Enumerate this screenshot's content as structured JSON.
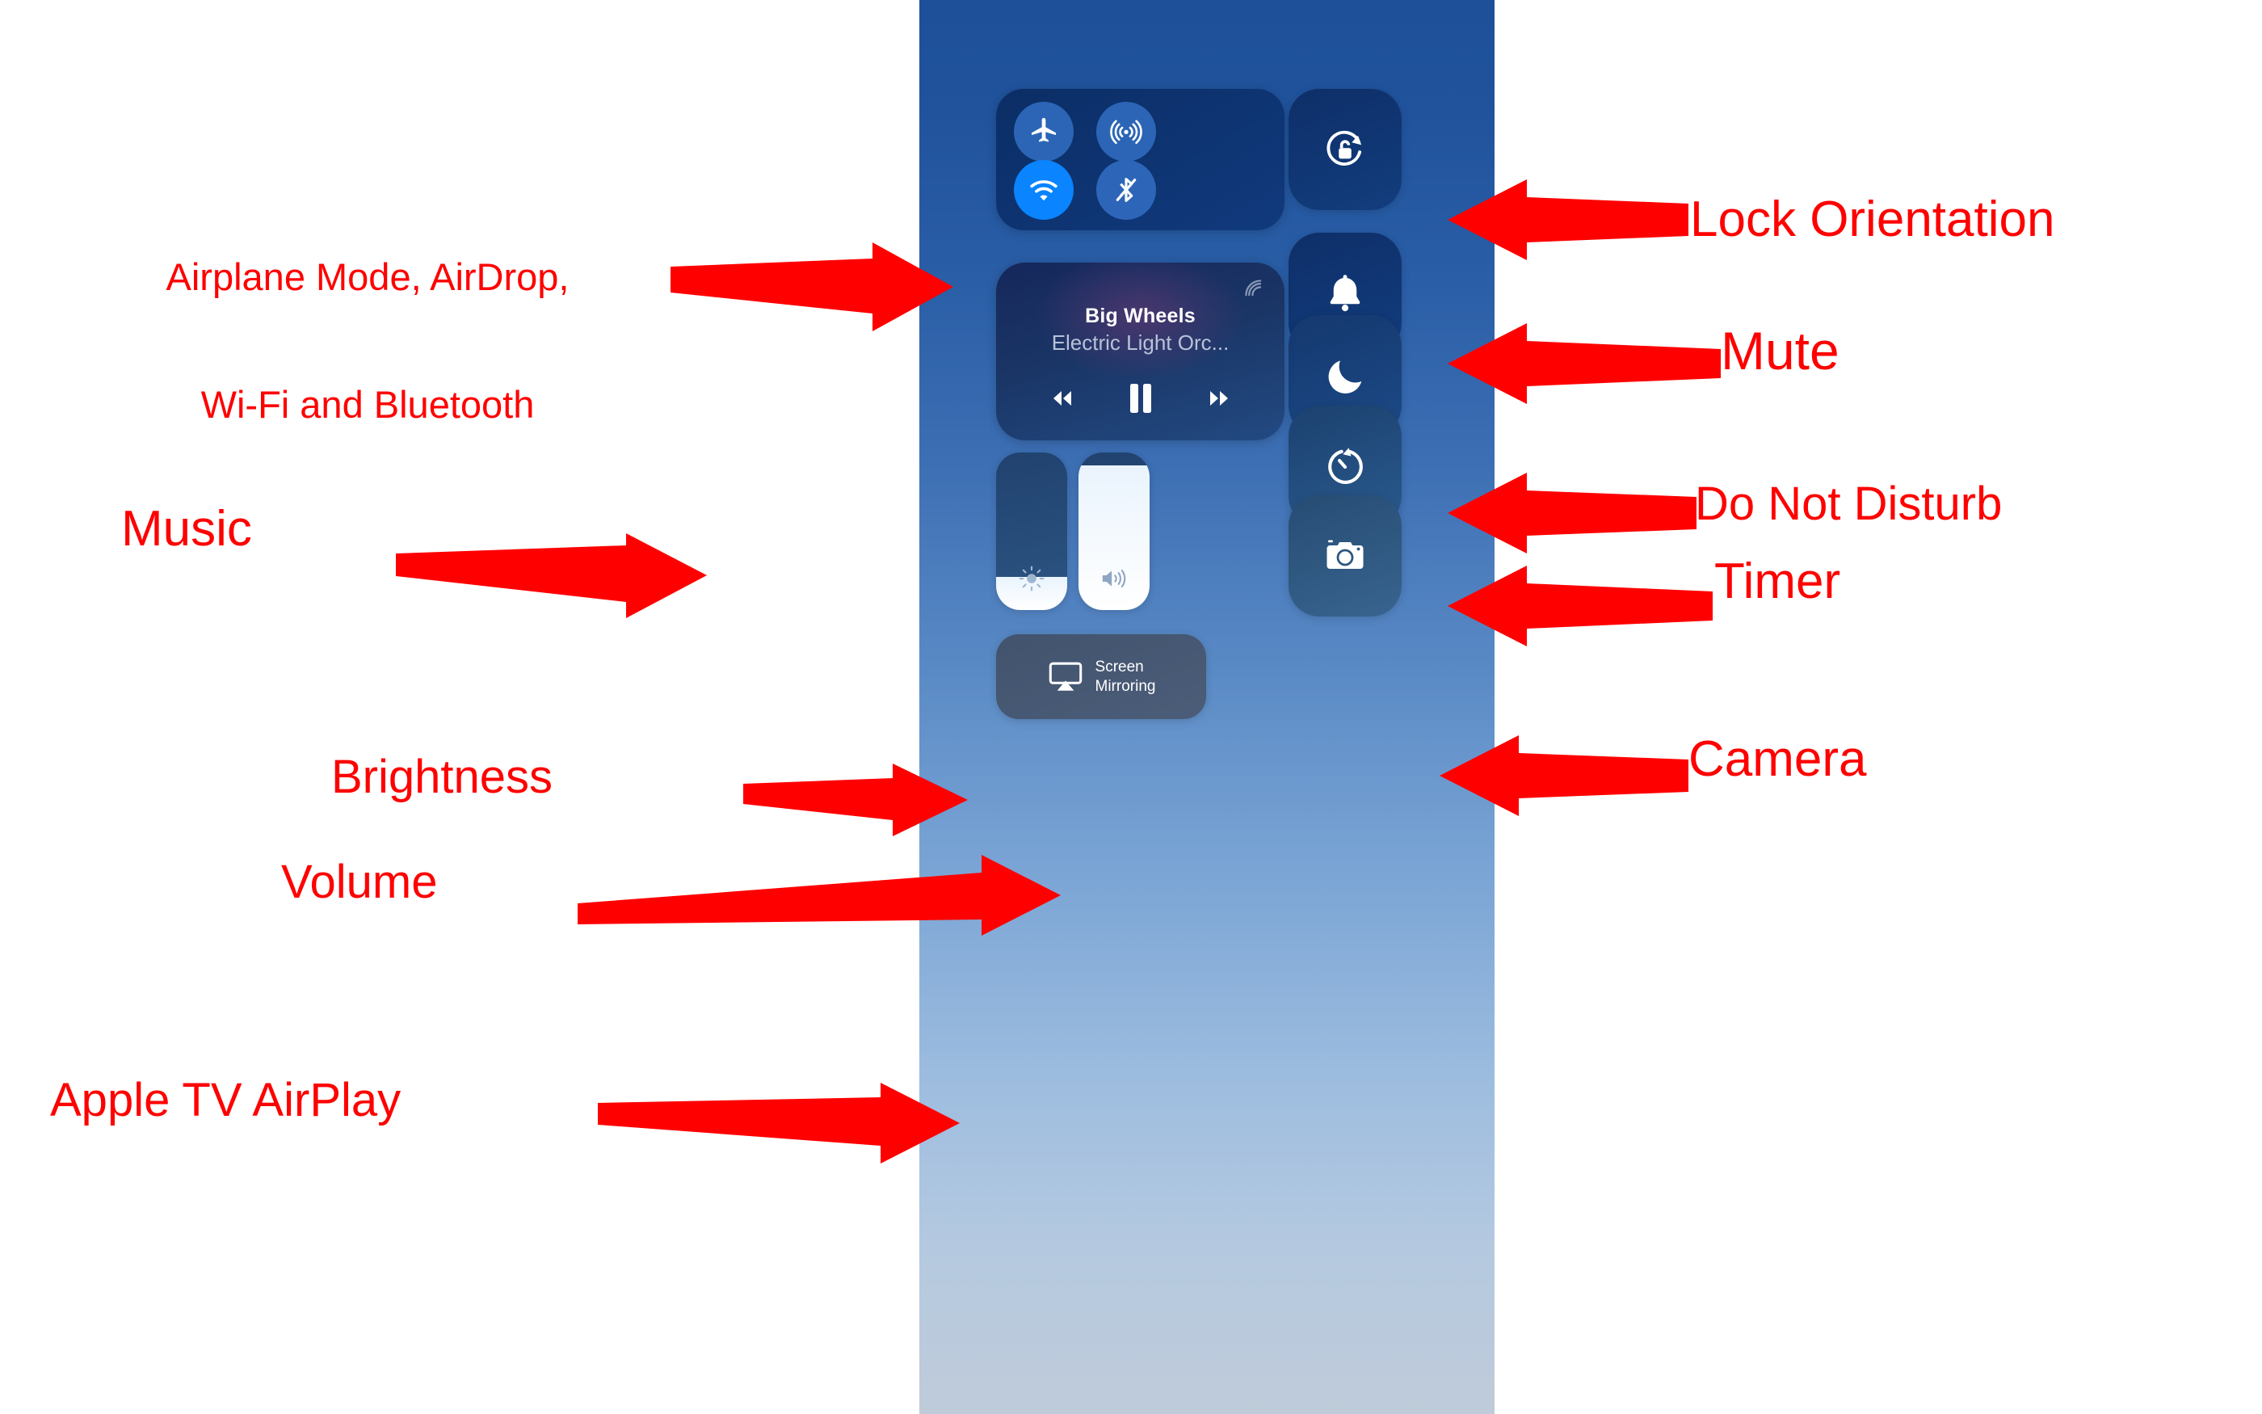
{
  "image": {
    "kind": "annotated-screenshot",
    "subject": "iOS Control Center",
    "annotation_color": "#FF0000",
    "panel": {
      "background_top_color": "#1D5099",
      "background_bottom_color": "#BFCBD9"
    }
  },
  "control_center": {
    "connectivity": {
      "group_name": "connectivity-group",
      "toggles": [
        {
          "name": "airplane-mode",
          "icon": "airplane-icon",
          "state": "off"
        },
        {
          "name": "airdrop",
          "icon": "airdrop-icon",
          "state": "off"
        },
        {
          "name": "wifi",
          "icon": "wifi-icon",
          "state": "on"
        },
        {
          "name": "bluetooth",
          "icon": "bluetooth-off-icon",
          "state": "off"
        }
      ]
    },
    "music": {
      "title": "Big Wheels",
      "artist": "Electric Light Orc...",
      "airplay_icon": "airplay-audio-icon",
      "controls": [
        {
          "name": "rewind-button",
          "icon": "rewind-icon"
        },
        {
          "name": "pause-button",
          "icon": "pause-icon"
        },
        {
          "name": "fast-forward-button",
          "icon": "fast-forward-icon"
        }
      ]
    },
    "toggles_column": [
      {
        "name": "lock-orientation",
        "icon": "rotation-lock-icon"
      },
      {
        "name": "mute",
        "icon": "bell-icon"
      },
      {
        "name": "do-not-disturb",
        "icon": "moon-icon"
      },
      {
        "name": "timer",
        "icon": "timer-icon"
      },
      {
        "name": "camera",
        "icon": "camera-icon"
      }
    ],
    "sliders": [
      {
        "name": "brightness-slider",
        "icon": "brightness-icon",
        "level_percent": 21
      },
      {
        "name": "volume-slider",
        "icon": "volume-icon",
        "level_percent": 92
      }
    ],
    "screen_mirroring": {
      "label_line1": "Screen",
      "label_line2": "Mirroring",
      "icon": "airplay-video-icon"
    }
  },
  "annotations": {
    "left": [
      {
        "id": "connectivity",
        "line1": "Airplane Mode, AirDrop,",
        "line2": "Wi-Fi and Bluetooth"
      },
      {
        "id": "music",
        "text": "Music"
      },
      {
        "id": "brightness",
        "text": "Brightness"
      },
      {
        "id": "volume",
        "text": "Volume"
      },
      {
        "id": "airplay",
        "text": "Apple TV AirPlay"
      }
    ],
    "right": [
      {
        "id": "lock-orientation",
        "text": "Lock Orientation"
      },
      {
        "id": "mute",
        "text": "Mute"
      },
      {
        "id": "do-not-disturb",
        "text": "Do Not Disturb"
      },
      {
        "id": "timer",
        "text": "Timer"
      },
      {
        "id": "camera",
        "text": "Camera"
      }
    ]
  }
}
